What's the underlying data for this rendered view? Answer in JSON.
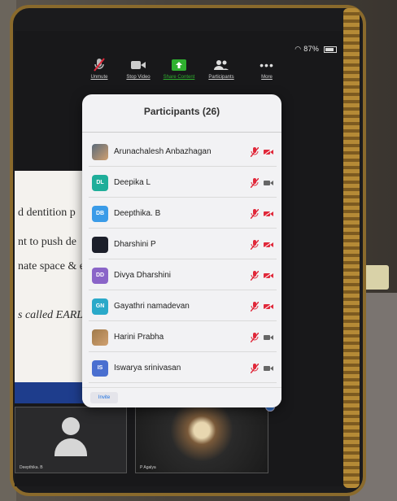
{
  "status": {
    "battery": "87%"
  },
  "toolbar": {
    "unmute": "Unmute",
    "stop_video": "Stop Video",
    "share": "Share Content",
    "participants": "Participants",
    "more": "More"
  },
  "panel": {
    "title": "Participants (26)",
    "invite": "Invite",
    "participants": [
      {
        "initials": "",
        "name": "Arunachalesh Anbazhagan",
        "color": "#5a6a7a",
        "photo": true,
        "mic": "muted",
        "cam": "off"
      },
      {
        "initials": "DL",
        "name": "Deepika L",
        "color": "#1fae9a",
        "mic": "muted",
        "cam": "on"
      },
      {
        "initials": "DB",
        "name": "Deepthika. B",
        "color": "#3a9be8",
        "mic": "muted",
        "cam": "off"
      },
      {
        "initials": "",
        "name": "Dharshini P",
        "color": "#1c1f2a",
        "mic": "muted",
        "cam": "off"
      },
      {
        "initials": "DD",
        "name": "Divya Dharshini",
        "color": "#8a64c8",
        "mic": "muted",
        "cam": "off"
      },
      {
        "initials": "GN",
        "name": "Gayathri namadevan",
        "color": "#2aa9c9",
        "mic": "muted",
        "cam": "off"
      },
      {
        "initials": "",
        "name": "Harini Prabha",
        "color": "#a07a4a",
        "photo": true,
        "mic": "muted",
        "cam": "on"
      },
      {
        "initials": "IS",
        "name": "Iswarya srinivasan",
        "color": "#4a6fd0",
        "mic": "muted",
        "cam": "on"
      }
    ]
  },
  "slide": {
    "lines": [
      "d dentition p",
      "nt to push de",
      "nate space & e",
      "s called EARL"
    ]
  },
  "thumbs": [
    {
      "name": "Deepthika. B"
    },
    {
      "name": "P Agalya"
    }
  ],
  "colors": {
    "muted": "#e0283a",
    "accent": "#1a6fe0",
    "share": "#2fb02f"
  }
}
